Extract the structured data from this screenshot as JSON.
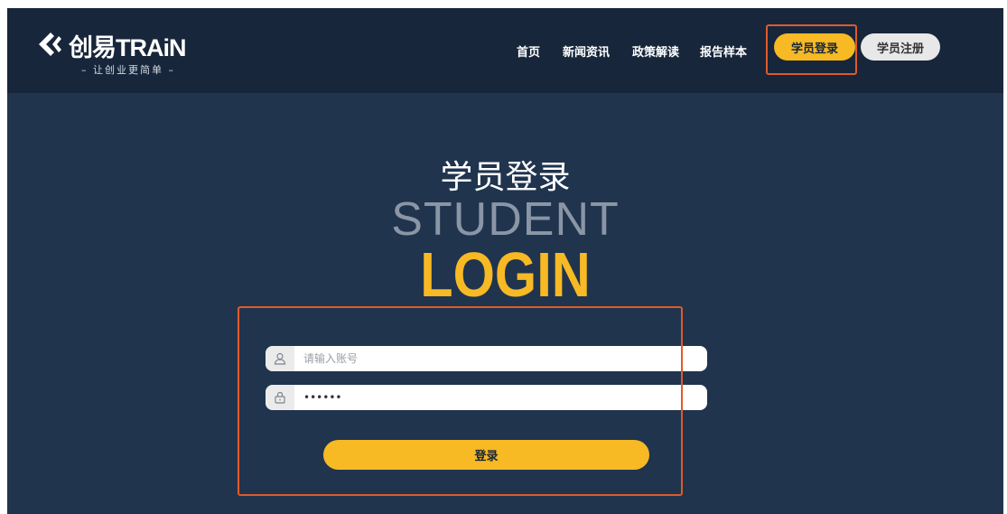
{
  "header": {
    "logo": {
      "brand_text": "创易TRAiN",
      "slogan": "– 让创业更简单 –"
    },
    "nav": [
      {
        "label": "首页"
      },
      {
        "label": "新闻资讯"
      },
      {
        "label": "政策解读"
      },
      {
        "label": "报告样本"
      }
    ],
    "login_button": "学员登录",
    "register_button": "学员注册"
  },
  "hero": {
    "title_cn": "学员登录",
    "title_en_line1": "STUDENT",
    "title_en_line2": "LOGIN"
  },
  "form": {
    "username": {
      "placeholder": "请输入账号",
      "value": "",
      "icon": "user-icon"
    },
    "password": {
      "placeholder": "",
      "value": "••••••",
      "icon": "lock-icon"
    },
    "submit_label": "登录"
  },
  "colors": {
    "background": "#20344e",
    "header": "#17263a",
    "accent": "#f7b924",
    "highlight": "#e05a2b"
  }
}
